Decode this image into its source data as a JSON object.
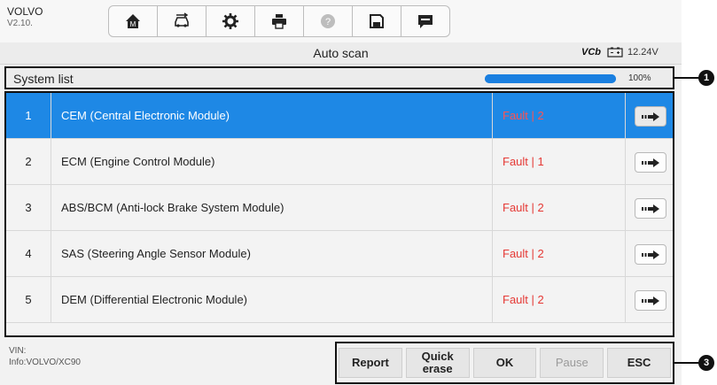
{
  "header": {
    "brand": "VOLVO",
    "version": "V2.10.",
    "toolbar": [
      {
        "name": "home-icon",
        "glyph": "M"
      },
      {
        "name": "vehicle-swap-icon"
      },
      {
        "name": "settings-icon"
      },
      {
        "name": "print-icon"
      },
      {
        "name": "help-icon"
      },
      {
        "name": "save-icon"
      },
      {
        "name": "data-logging-icon"
      }
    ]
  },
  "titlebar": {
    "title": "Auto scan",
    "vci_label": "VCb",
    "voltage": "12.24V"
  },
  "system_list": {
    "label": "System list",
    "progress_fraction": 1.0,
    "progress_text": "100%"
  },
  "rows": [
    {
      "num": "1",
      "name": "CEM (Central Electronic Module)",
      "fault": "Fault | 2",
      "selected": true
    },
    {
      "num": "2",
      "name": "ECM (Engine Control Module)",
      "fault": "Fault | 1",
      "selected": false
    },
    {
      "num": "3",
      "name": "ABS/BCM (Anti-lock Brake System Module)",
      "fault": "Fault | 2",
      "selected": false
    },
    {
      "num": "4",
      "name": "SAS (Steering Angle Sensor Module)",
      "fault": "Fault | 2",
      "selected": false
    },
    {
      "num": "5",
      "name": "DEM (Differential Electronic Module)",
      "fault": "Fault | 2",
      "selected": false
    }
  ],
  "footer": {
    "vin": "VIN:",
    "info": "Info:VOLVO/XC90"
  },
  "actions": [
    {
      "label": "Report",
      "name": "report-button",
      "disabled": false
    },
    {
      "label": "Quick\nerase",
      "name": "quick-erase-button",
      "disabled": false
    },
    {
      "label": "OK",
      "name": "ok-button",
      "disabled": false
    },
    {
      "label": "Pause",
      "name": "pause-button",
      "disabled": true
    },
    {
      "label": "ESC",
      "name": "esc-button",
      "disabled": false
    }
  ],
  "callouts": [
    "1",
    "3"
  ]
}
